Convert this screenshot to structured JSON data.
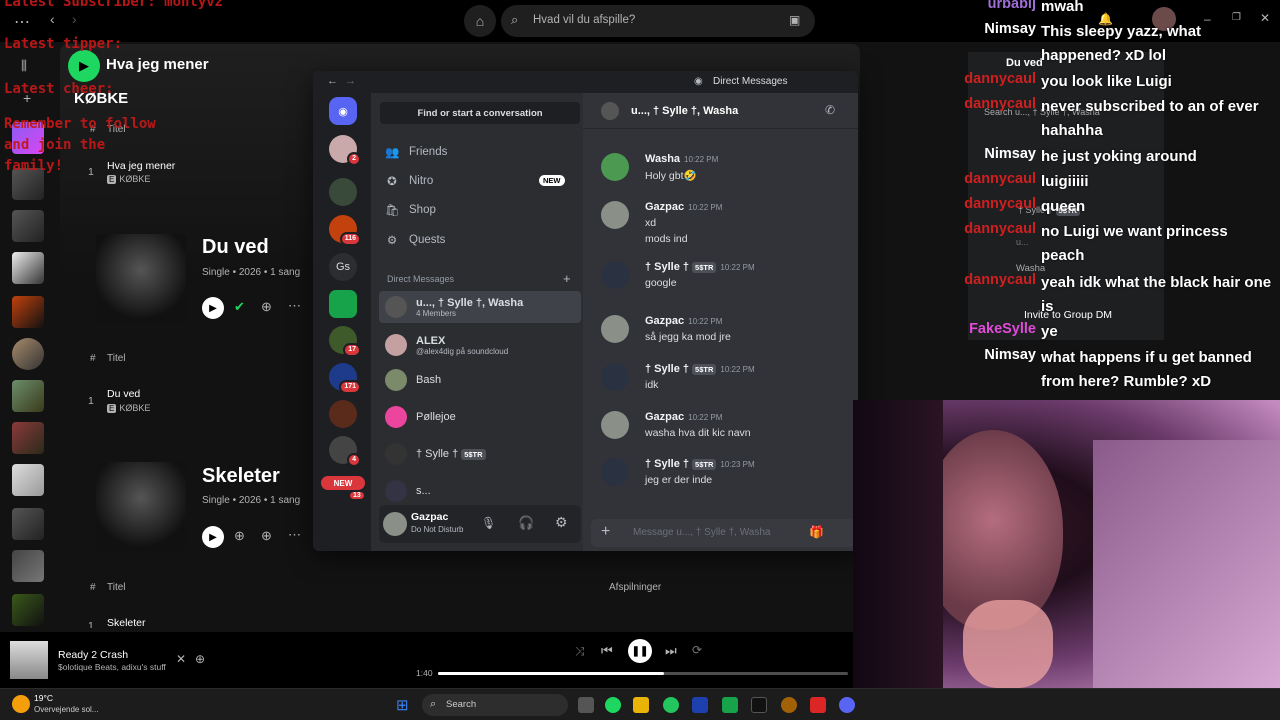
{
  "spotify": {
    "search_placeholder": "Hvad vil du afspille?",
    "now_title": "Hva jeg mener",
    "artist_header": "KØBKE",
    "col_title": "Titel",
    "col_plays": "Afspilninger",
    "sections": [
      {
        "track_num": "1",
        "track": "Hva jeg mener",
        "artist": "KØBKE"
      },
      {
        "album": "Du ved",
        "meta": "Single • 2026 • 1 sang",
        "track_num": "1",
        "track": "Du ved",
        "artist": "KØBKE"
      },
      {
        "album": "Skeleter",
        "meta": "Single • 2026 • 1 sang",
        "track_num": "1",
        "track": "Skeleter"
      }
    ],
    "explicit": "E",
    "player": {
      "title": "Ready 2 Crash",
      "artists": "$olotique Beats, adixu's stuff",
      "elapsed": "1:40",
      "progress": 0.55
    }
  },
  "overlay": {
    "latest_subscriber": "Latest Subscriber: montyv2",
    "latest_tipper": "Latest tipper:",
    "latest_cheer": "Latest cheer:",
    "remember": "Remember to follow and join the family!"
  },
  "taskbar": {
    "temp": "19°C",
    "weather": "Overvejende sol...",
    "search": "Search"
  },
  "discord": {
    "title": "Direct Messages",
    "find": "Find or start a conversation",
    "nav": [
      {
        "label": "Friends",
        "icon": "friends-icon"
      },
      {
        "label": "Nitro",
        "icon": "nitro-icon",
        "badge": "NEW"
      },
      {
        "label": "Shop",
        "icon": "shop-icon"
      },
      {
        "label": "Quests",
        "icon": "quests-icon"
      }
    ],
    "dm_header": "Direct Messages",
    "dms": [
      {
        "name": "u..., † Sylle †, Washa",
        "sub": "4 Members"
      },
      {
        "name": "ALEX",
        "sub": "@alex4dig på soundcloud"
      },
      {
        "name": "Bash",
        "sub": ""
      },
      {
        "name": "Pøllejoe",
        "sub": ""
      },
      {
        "name": "† Sylle †",
        "sub": "",
        "tag": "5$TR"
      },
      {
        "name": "s...",
        "sub": ""
      }
    ],
    "user": {
      "name": "Gazpac",
      "status": "Do Not Disturb"
    },
    "server_badges": [
      "2",
      "116",
      "17",
      "171",
      "4",
      "13"
    ],
    "server_text": "Gs",
    "new_pill": "NEW",
    "chat_header": "u..., † Sylle †, Washa",
    "members_search": "Search u..., † Sylle †, Washa",
    "messages": [
      {
        "user": "Washa",
        "time": "10:22 PM",
        "lines": [
          "Holy gbt🤣"
        ]
      },
      {
        "user": "Gazpac",
        "time": "10:22 PM",
        "lines": [
          "xd",
          "mods ind"
        ]
      },
      {
        "user": "† Sylle †",
        "tag": "5$TR",
        "time": "10:22 PM",
        "lines": [
          "google"
        ]
      },
      {
        "user": "Gazpac",
        "time": "10:22 PM",
        "lines": [
          "så jegg ka mod jre"
        ]
      },
      {
        "user": "† Sylle †",
        "tag": "5$TR",
        "time": "10:22 PM",
        "lines": [
          "idk"
        ]
      },
      {
        "user": "Gazpac",
        "time": "10:22 PM",
        "lines": [
          "washa hva  dit kic navn"
        ]
      },
      {
        "user": "† Sylle †",
        "tag": "5$TR",
        "time": "10:23 PM",
        "lines": [
          "jeg er der inde"
        ]
      }
    ],
    "input_placeholder": "Message u..., † Sylle †, Washa",
    "members_panel": {
      "title": "Du ved",
      "members": [
        "† Sylle †",
        "u...",
        "Washa"
      ],
      "tag": "5$TR",
      "invite": "Invite to Group DM"
    }
  },
  "stream_chat": [
    {
      "user": "urbabij",
      "color": "#9e6fd6",
      "msg": "mwah"
    },
    {
      "user": "Nimsay",
      "color": "#ffffff",
      "msg": "This sleepy yazz, what happened? xD lol"
    },
    {
      "user": "dannycaul",
      "color": "#d01f1f",
      "msg": "you look like Luigi"
    },
    {
      "user": "dannycaul",
      "color": "#d01f1f",
      "msg": "never subscribed to an of ever hahahha"
    },
    {
      "user": "Nimsay",
      "color": "#ffffff",
      "msg": "he just yoking around"
    },
    {
      "user": "dannycaul",
      "color": "#d01f1f",
      "msg": "luigiiiii"
    },
    {
      "user": "dannycaul",
      "color": "#d01f1f",
      "msg": "queen"
    },
    {
      "user": "dannycaul",
      "color": "#d01f1f",
      "msg": "no Luigi we want princess peach"
    },
    {
      "user": "dannycaul",
      "color": "#d01f1f",
      "msg": "yeah idk what the black hair one is"
    },
    {
      "user": "FakeSylle",
      "color": "#e04bd8",
      "msg": "ye"
    },
    {
      "user": "Nimsay",
      "color": "#ffffff",
      "msg": "what happens if u get banned from here? Rumble? xD"
    }
  ]
}
